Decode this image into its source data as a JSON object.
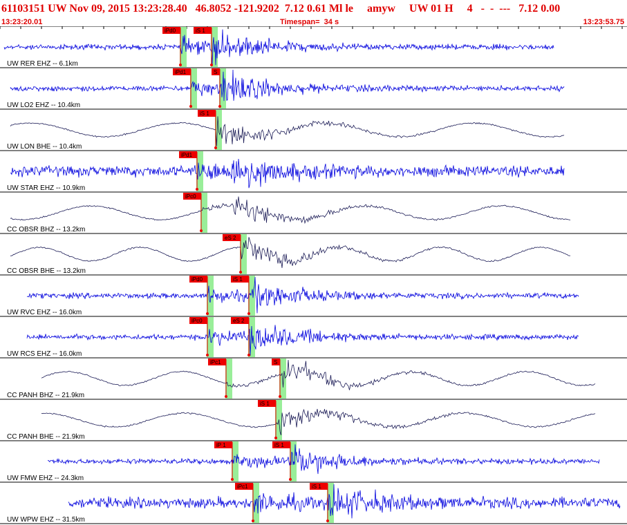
{
  "header": {
    "title": "61103151 UW Nov 09, 2015 13:23:28.40   46.8052 -121.9202  7.12 0.61 Ml le     amyw     UW 01 H     4   -  -  ---   7.12 0.00",
    "start_time": "13:23:20.01",
    "timespan": "Timespan=  34 s",
    "end_time": "13:23:53.75"
  },
  "colors": {
    "hf_trace": "#0000dd",
    "lp_trace": "#1a1a55",
    "pick_flag": "#ee0000",
    "pick_window": "#99ee99",
    "header_text": "#e00000"
  },
  "traces": [
    {
      "label": "UW RER EHZ -- 6.1km",
      "type": "hf",
      "start": 0.2,
      "end": 26.7,
      "picks": [
        {
          "text": "iPd0",
          "t": 8.7
        },
        {
          "text": "iS 1",
          "t": 10.2
        }
      ]
    },
    {
      "label": "UW LO2 EHZ -- 10.4km",
      "type": "hf",
      "start": 0.5,
      "end": 27.2,
      "picks": [
        {
          "text": "iPd1",
          "t": 9.2
        },
        {
          "text": "S",
          "t": 10.6
        }
      ]
    },
    {
      "label": "UW LON BHE -- 10.4km",
      "type": "lp",
      "start": 0.5,
      "end": 27.2,
      "picks": [
        {
          "text": "iS 1",
          "t": 10.4
        }
      ]
    },
    {
      "label": "UW STAR EHZ -- 10.9km",
      "type": "hf",
      "start": 0.5,
      "end": 27.2,
      "picks": [
        {
          "text": "iPd1",
          "t": 9.5
        }
      ]
    },
    {
      "label": "CC OBSR BHZ -- 13.2km",
      "type": "lp",
      "start": 0.5,
      "end": 27.5,
      "picks": [
        {
          "text": "iPc0",
          "t": 9.7
        }
      ]
    },
    {
      "label": "CC OBSR BHE -- 13.2km",
      "type": "lp",
      "start": 0.5,
      "end": 27.5,
      "picks": [
        {
          "text": "eS 2",
          "t": 11.6
        }
      ]
    },
    {
      "label": "UW RVC EHZ -- 16.0km",
      "type": "hf",
      "start": 1.3,
      "end": 27.9,
      "picks": [
        {
          "text": "iPd0",
          "t": 10.0
        },
        {
          "text": "iS 1",
          "t": 12.0
        }
      ]
    },
    {
      "label": "UW RCS EHZ -- 16.0km",
      "type": "hf",
      "start": 1.3,
      "end": 27.9,
      "picks": [
        {
          "text": "iPc0",
          "t": 10.0
        },
        {
          "text": "eS 2",
          "t": 12.0
        }
      ]
    },
    {
      "label": "CC PANH BHZ -- 21.9km",
      "type": "lp",
      "start": 2.0,
      "end": 28.7,
      "picks": [
        {
          "text": "iPc1",
          "t": 10.9
        },
        {
          "text": "S",
          "t": 13.5
        }
      ]
    },
    {
      "label": "CC PANH BHE -- 21.9km",
      "type": "lp",
      "start": 2.0,
      "end": 28.7,
      "picks": [
        {
          "text": "iS 1",
          "t": 13.3
        }
      ]
    },
    {
      "label": "UW FMW EHZ -- 24.3km",
      "type": "hf",
      "start": 2.3,
      "end": 28.9,
      "picks": [
        {
          "text": "iP 1",
          "t": 11.2
        },
        {
          "text": "iS 1",
          "t": 14.0
        }
      ]
    },
    {
      "label": "UW WPW EHZ -- 31.5km",
      "type": "hf",
      "start": 3.3,
      "end": 29.9,
      "picks": [
        {
          "text": "iPc1",
          "t": 12.2
        },
        {
          "text": "iS 1",
          "t": 15.8
        }
      ]
    }
  ]
}
